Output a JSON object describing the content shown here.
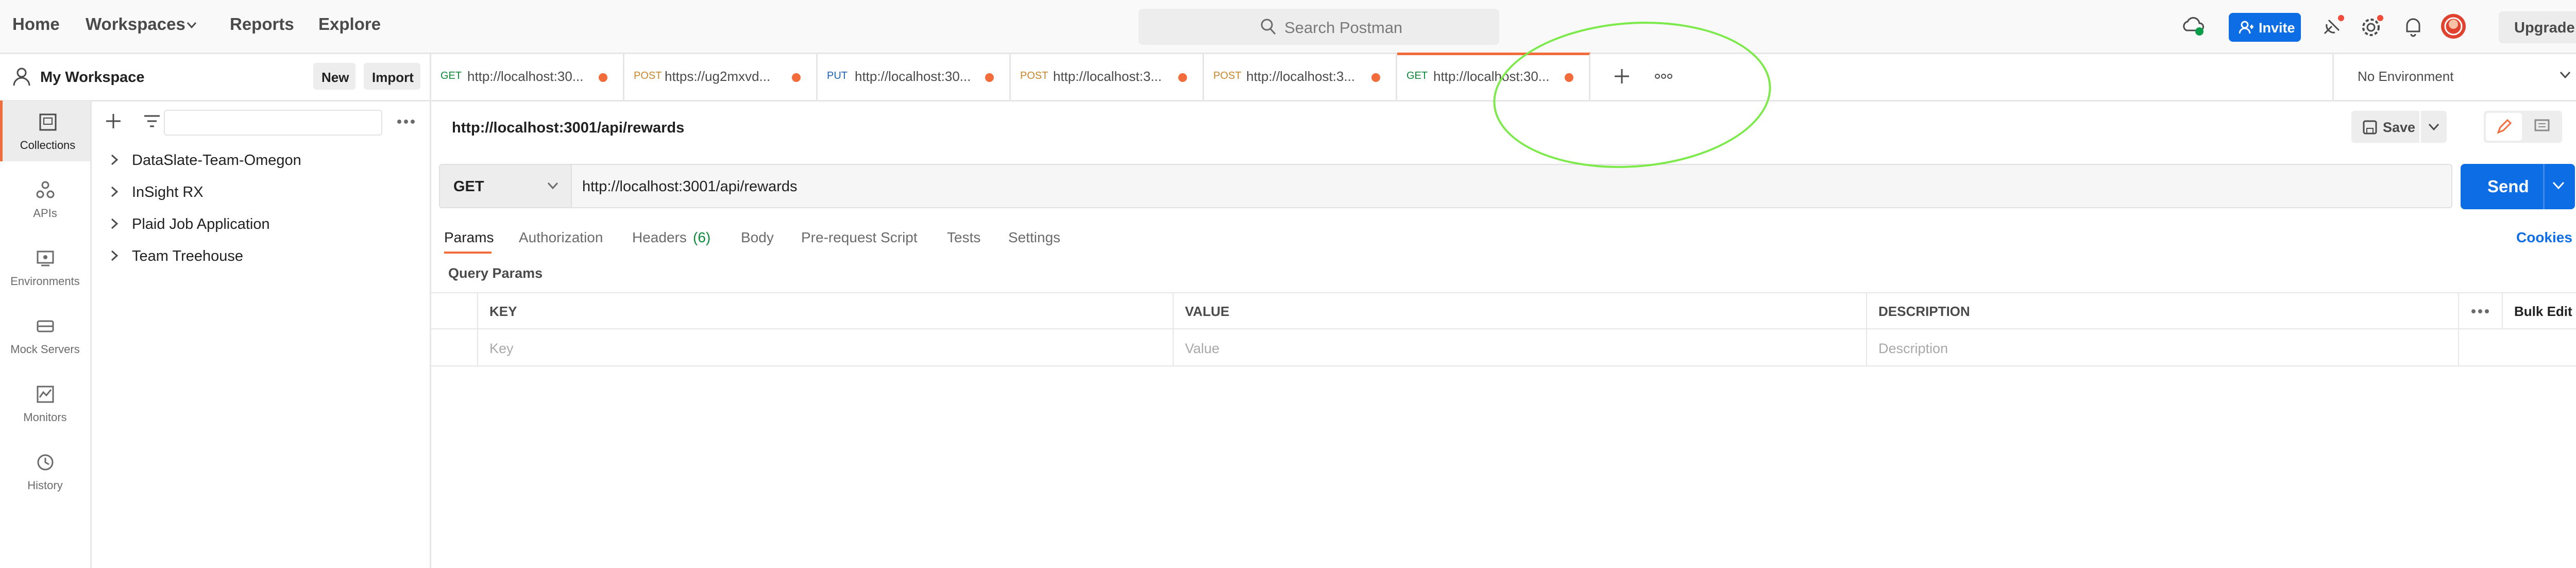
{
  "header": {
    "nav": [
      "Home",
      "Workspaces",
      "Reports",
      "Explore"
    ],
    "search_placeholder": "Search Postman",
    "invite_label": "Invite",
    "upgrade_label": "Upgrade",
    "accent_color": "#f26b3a",
    "brand_blue": "#0d6de5"
  },
  "workspace": {
    "title": "My Workspace",
    "new_label": "New",
    "import_label": "Import"
  },
  "rail": {
    "items": [
      "Collections",
      "APIs",
      "Environments",
      "Mock Servers",
      "Monitors",
      "History"
    ],
    "active": "Collections"
  },
  "collections": [
    "DataSlate-Team-Omegon",
    "InSight RX",
    "Plaid Job Application",
    "Team Treehouse"
  ],
  "tabs": [
    {
      "method": "GET",
      "url": "http://localhost:30...",
      "method_color": "#0b8a3a"
    },
    {
      "method": "POST",
      "url": "https://ug2mxvd...",
      "method_color": "#c8852a"
    },
    {
      "method": "PUT",
      "url": "http://localhost:30...",
      "method_color": "#1f5fb8"
    },
    {
      "method": "POST",
      "url": "http://localhost:3...",
      "method_color": "#c8852a"
    },
    {
      "method": "POST",
      "url": "http://localhost:3...",
      "method_color": "#c8852a"
    },
    {
      "method": "GET",
      "url": "http://localhost:30...",
      "method_color": "#0b8a3a",
      "active": true
    }
  ],
  "environment": "No Environment",
  "request": {
    "title": "http://localhost:3001/api/rewards",
    "save_label": "Save",
    "method": "GET",
    "url": "http://localhost:3001/api/rewards",
    "send_label": "Send",
    "tabs": {
      "params": "Params",
      "authorization": "Authorization",
      "headers": "Headers",
      "headers_count": "(6)",
      "body": "Body",
      "prerequest": "Pre-request Script",
      "tests": "Tests",
      "settings": "Settings"
    },
    "cookies_label": "Cookies",
    "query_params_title": "Query Params",
    "table": {
      "headers": [
        "KEY",
        "VALUE",
        "DESCRIPTION"
      ],
      "placeholders": [
        "Key",
        "Value",
        "Description"
      ],
      "bulk_edit": "Bulk Edit"
    }
  }
}
